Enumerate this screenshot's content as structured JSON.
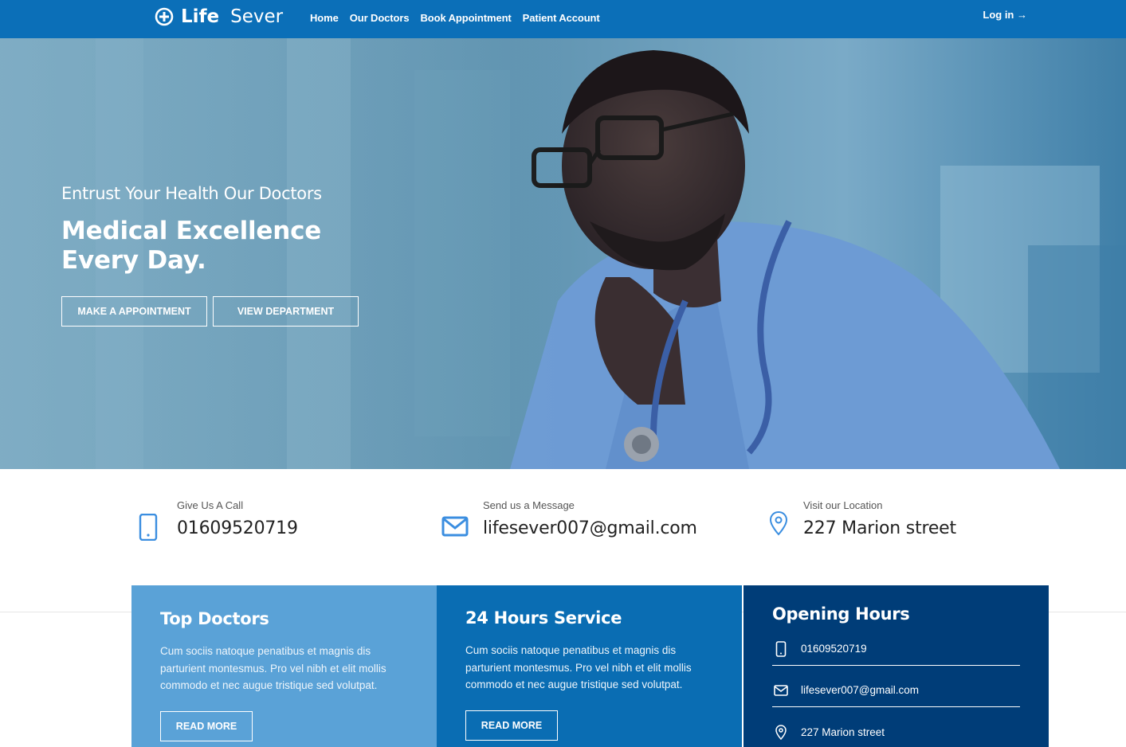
{
  "brand": {
    "name_bold": "Life",
    "name_light": "Sever"
  },
  "nav": {
    "items": [
      {
        "label": "Home"
      },
      {
        "label": "Our Doctors"
      },
      {
        "label": "Book Appointment"
      },
      {
        "label": "Patient Account"
      }
    ],
    "login_label": "Log in →"
  },
  "hero": {
    "subtitle": "Entrust Your Health Our Doctors",
    "title": "Medical Excellence Every Day.",
    "buttons": {
      "appointment": "MAKE A APPOINTMENT",
      "department": "VIEW DEPARTMENT"
    }
  },
  "contact": {
    "call": {
      "label": "Give Us A Call",
      "value": "01609520719",
      "icon": "phone-icon"
    },
    "message": {
      "label": "Send us a Message",
      "value": "lifesever007@gmail.com",
      "icon": "mail-icon"
    },
    "location": {
      "label": "Visit our Location",
      "value": "227 Marion street",
      "icon": "location-pin-icon"
    }
  },
  "cards": {
    "top_doctors": {
      "title": "Top Doctors",
      "text": "Cum sociis natoque penatibus et magnis dis parturient montesmus. Pro vel nibh et elit mollis commodo et nec augue tristique sed volutpat.",
      "button": "READ MORE"
    },
    "service": {
      "title": "24 Hours Service",
      "text": "Cum sociis natoque penatibus et magnis dis parturient montesmus. Pro vel nibh et elit mollis commodo et nec augue tristique sed volutpat.",
      "button": "READ MORE"
    },
    "opening_hours": {
      "title": "Opening Hours",
      "phone": "01609520719",
      "email": "lifesever007@gmail.com",
      "address": "227 Marion street"
    }
  },
  "colors": {
    "navbar": "#0b6fb8",
    "card_light": "#5aa2d7",
    "card_mid": "#0a6db3",
    "card_dark": "#003d78",
    "icon_blue": "#3b8ee0"
  }
}
